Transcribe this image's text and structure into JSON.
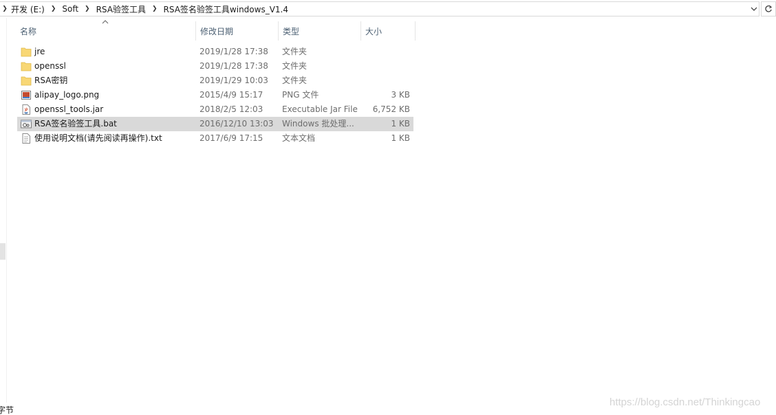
{
  "address_bar": {
    "crumbs": [
      "开发 (E:)",
      "Soft",
      "RSA验签工具",
      "RSA签名验签工具windows_V1.4"
    ],
    "dropdown_icon": "chevron-down-icon",
    "refresh_icon": "refresh-icon"
  },
  "columns": {
    "name": "名称",
    "date": "修改日期",
    "type": "类型",
    "size": "大小",
    "sort": "name-ascending"
  },
  "files": [
    {
      "name": "jre",
      "date": "2019/1/28 17:38",
      "type": "文件夹",
      "size": "",
      "icon": "folder-icon"
    },
    {
      "name": "openssl",
      "date": "2019/1/28 17:38",
      "type": "文件夹",
      "size": "",
      "icon": "folder-icon"
    },
    {
      "name": "RSA密钥",
      "date": "2019/1/29 10:03",
      "type": "文件夹",
      "size": "",
      "icon": "folder-icon"
    },
    {
      "name": "alipay_logo.png",
      "date": "2015/4/9 15:17",
      "type": "PNG 文件",
      "size": "3 KB",
      "icon": "image-file-icon"
    },
    {
      "name": "openssl_tools.jar",
      "date": "2018/2/5 12:03",
      "type": "Executable Jar File",
      "size": "6,752 KB",
      "icon": "java-file-icon"
    },
    {
      "name": "RSA签名验签工具.bat",
      "date": "2016/12/10 13:03",
      "type": "Windows 批处理...",
      "size": "1 KB",
      "icon": "batch-file-icon",
      "selected": true
    },
    {
      "name": "使用说明文档(请先阅读再操作).txt",
      "date": "2017/6/9 17:15",
      "type": "文本文档",
      "size": "1 KB",
      "icon": "text-file-icon"
    }
  ],
  "status_bar": {
    "text": "字节"
  },
  "watermark": "https://blog.csdn.net/Thinkingcao",
  "colors": {
    "selected_row": "#d9d9d9",
    "header_text": "#4c6073",
    "folder": "#f8d775"
  }
}
